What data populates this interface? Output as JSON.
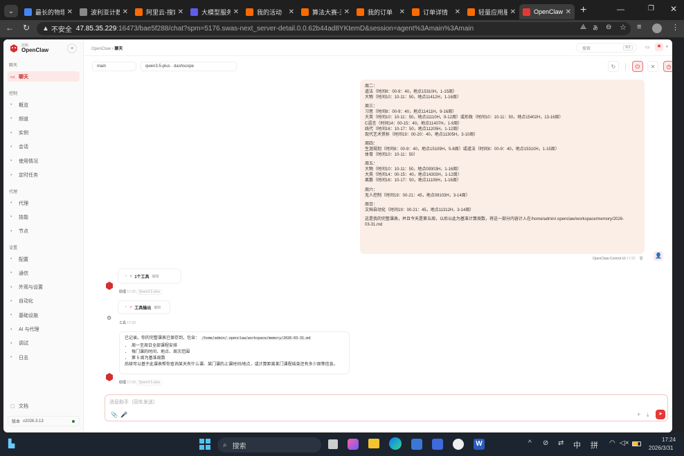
{
  "browser": {
    "tabs": [
      {
        "title": "最长的物理",
        "color": "#4285f4"
      },
      {
        "title": "波利亚计数",
        "color": "#888"
      },
      {
        "title": "阿里云-搜索",
        "color": "#ff6a00"
      },
      {
        "title": "大模型服务",
        "color": "#615ced"
      },
      {
        "title": "我的活动",
        "color": "#ff6a00"
      },
      {
        "title": "算法大赛-天",
        "color": "#ff6a00"
      },
      {
        "title": "我的订单",
        "color": "#ff6a00"
      },
      {
        "title": "订单详情",
        "color": "#ff6a00"
      },
      {
        "title": "轻量应用服",
        "color": "#ff6a00"
      },
      {
        "title": "OpenClaw",
        "color": "#e53935"
      }
    ],
    "security": "不安全",
    "url_host": "47.85.35.229",
    "url_rest": ":16473/bae5f288/chat?spm=5176.swas-next_server-detail.0.0.62b44ad8YKtemD&session=agent%3Amain%3Amain"
  },
  "sidebar": {
    "logo_top": "控制",
    "logo_name": "OpenClaw",
    "sections": {
      "chat": "聊天",
      "control": "控制",
      "agent": "代理",
      "settings": "设置"
    },
    "chat_item": "聊天",
    "control_items": [
      "概览",
      "频道",
      "实例",
      "会话",
      "使用情况",
      "定时任务"
    ],
    "agent_items": [
      "代理",
      "技能",
      "节点"
    ],
    "settings_items": [
      "配置",
      "通信",
      "外观与设置",
      "自动化",
      "基础设施",
      "AI 与代理",
      "调试",
      "日志"
    ],
    "docs": "文档",
    "version_label": "版本",
    "version": "v2026.3.13"
  },
  "header": {
    "breadcrumb_root": "OpenClaw",
    "breadcrumb_sep": "›",
    "breadcrumb_page": "聊天",
    "search_placeholder": "搜索",
    "search_kbd": "⌘K"
  },
  "toolbar": {
    "session": "main",
    "model": "qwen3.5-plus · dashscope"
  },
  "user_message": {
    "lines": [
      "周二：",
      "道法（时间8：00-9：40，地点15310H，1-15周）",
      "大物（时间10：10-11：50，地点11412H，1-16周）",
      "",
      "周三：",
      "习思（时间8：00-9：40，地点11411H，9-16周）",
      "大英（时间10：10-11：50，地点11110H，9-12周）或形政（时间10：10-11：50，地点15402H，13-16周）",
      "C语言（时间14：00-15：40，地点11407H，1-9周）",
      "线代（时间16：10-17：50，地点11205H，1-12周）",
      "现代艺术赏析（时间19：00-20：40，地点11305H，3-10周）",
      "",
      "周四：",
      "生涯规划（时间8：00-9：40，地点15109H，5-8周）或道法（时间8：00-9：40，地点15310H，1-15周）",
      "体育（时间10：10-11：50）",
      "",
      "周五：",
      "大物（时间10：10-11：50，地点09303H，1-16周）",
      "大英（时间14：00-15：40，地点14303H，1-12周）",
      "离散（时间16：10-17：50，地点11109H，1-16周）",
      "",
      "周六：",
      "无人控制（时间19：00-21：45，地点09103H，3-14周）",
      "",
      "周日：",
      "文档自动化（时间19：00-21：45，地点11312H，3-14周）",
      "",
      "这是我的完整课表，并且今天是第五周，以后以此为基准计算周数，将这一部分内容计入在/home/admin/.openclaw/workspace/memory/2026-",
      "03-31.md"
    ],
    "sender": "OpenClaw-Control-UI",
    "time": "17:22"
  },
  "assistant": {
    "tool_card_1": "1个工具",
    "tool_card_1_action": "编辑",
    "assistant_name": "助理",
    "assistant_time": "17:22",
    "assistant_model": "Qwen3.5-plus",
    "tool_card_2": "工具输出",
    "tool_card_2_action": "编辑",
    "tool_name": "工具",
    "tool_time": "17:23",
    "reply_intro": "已记录。你的完整课表已保存到，包含：",
    "reply_path": "/home/admin/.openclaw/workspace/memory/2026-03-31.md",
    "reply_bullets": [
      "周一至周日全部课程安排",
      "每门课的时间、地点、周次范围",
      "第 5 周为基准周数"
    ],
    "reply_outro": "后续可以基于此课表帮你查询某天有什么课、某门课的上课时间/地点，或计算距离某门课程结束还有多少周等信息。",
    "reply_name": "助理",
    "reply_time": "17:23",
    "reply_model": "Qwen3.5-plus"
  },
  "composer": {
    "placeholder": "消息助手（回车发送）"
  },
  "taskbar": {
    "search": "搜索",
    "ime": "中",
    "ime2": "拼",
    "time": "17:24",
    "date": "2026/3/31"
  }
}
